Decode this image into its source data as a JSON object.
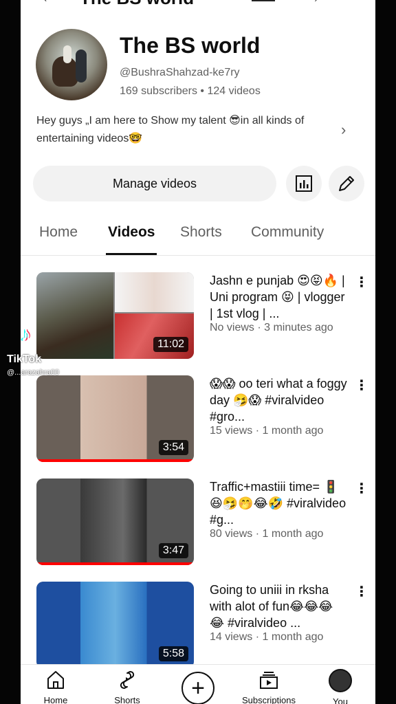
{
  "topbar": {
    "title": "The BS world"
  },
  "channel": {
    "name": "The BS world",
    "handle": "@BushraShahzad-ke7ry",
    "stats": "169 subscribers • 124 videos",
    "description": "Hey guys „I am here to Show my talent 😎in all kinds of entertaining videos🤓"
  },
  "actions": {
    "manage_label": "Manage videos"
  },
  "tabs": [
    {
      "label": "Home"
    },
    {
      "label": "Videos"
    },
    {
      "label": "Shorts"
    },
    {
      "label": "Community"
    }
  ],
  "active_tab": "Videos",
  "videos": [
    {
      "title": "Jashn e punjab 😍😝🔥 | Uni program 😝 | vlogger | 1st vlog | ...",
      "meta": "No views · 3 minutes ago",
      "duration": "11:02",
      "watched_fraction": 0
    },
    {
      "title": "😱😱 oo teri what a foggy day 🤧😱 #viralvideo #gro...",
      "meta": "15 views · 1 month ago",
      "duration": "3:54",
      "watched_fraction": 1
    },
    {
      "title": "Traffic+mastiii time= 🚦 😆🤧🤭😂🤣 #viralvideo #g...",
      "meta": "80 views · 1 month ago",
      "duration": "3:47",
      "watched_fraction": 1
    },
    {
      "title": "Going to uniii in rksha with alot of fun😂😂😂😂 #viralvideo ...",
      "meta": "14 views · 1 month ago",
      "duration": "5:58",
      "watched_fraction": 0
    }
  ],
  "bottom_nav": [
    {
      "label": "Home",
      "icon": "home-icon"
    },
    {
      "label": "Shorts",
      "icon": "shorts-icon"
    },
    {
      "label": "",
      "icon": "create-icon"
    },
    {
      "label": "Subscriptions",
      "icon": "subscriptions-icon"
    },
    {
      "label": "You",
      "icon": "account-avatar"
    }
  ],
  "watermark": {
    "brand": "TikTok",
    "user": "@...arazahra00"
  }
}
